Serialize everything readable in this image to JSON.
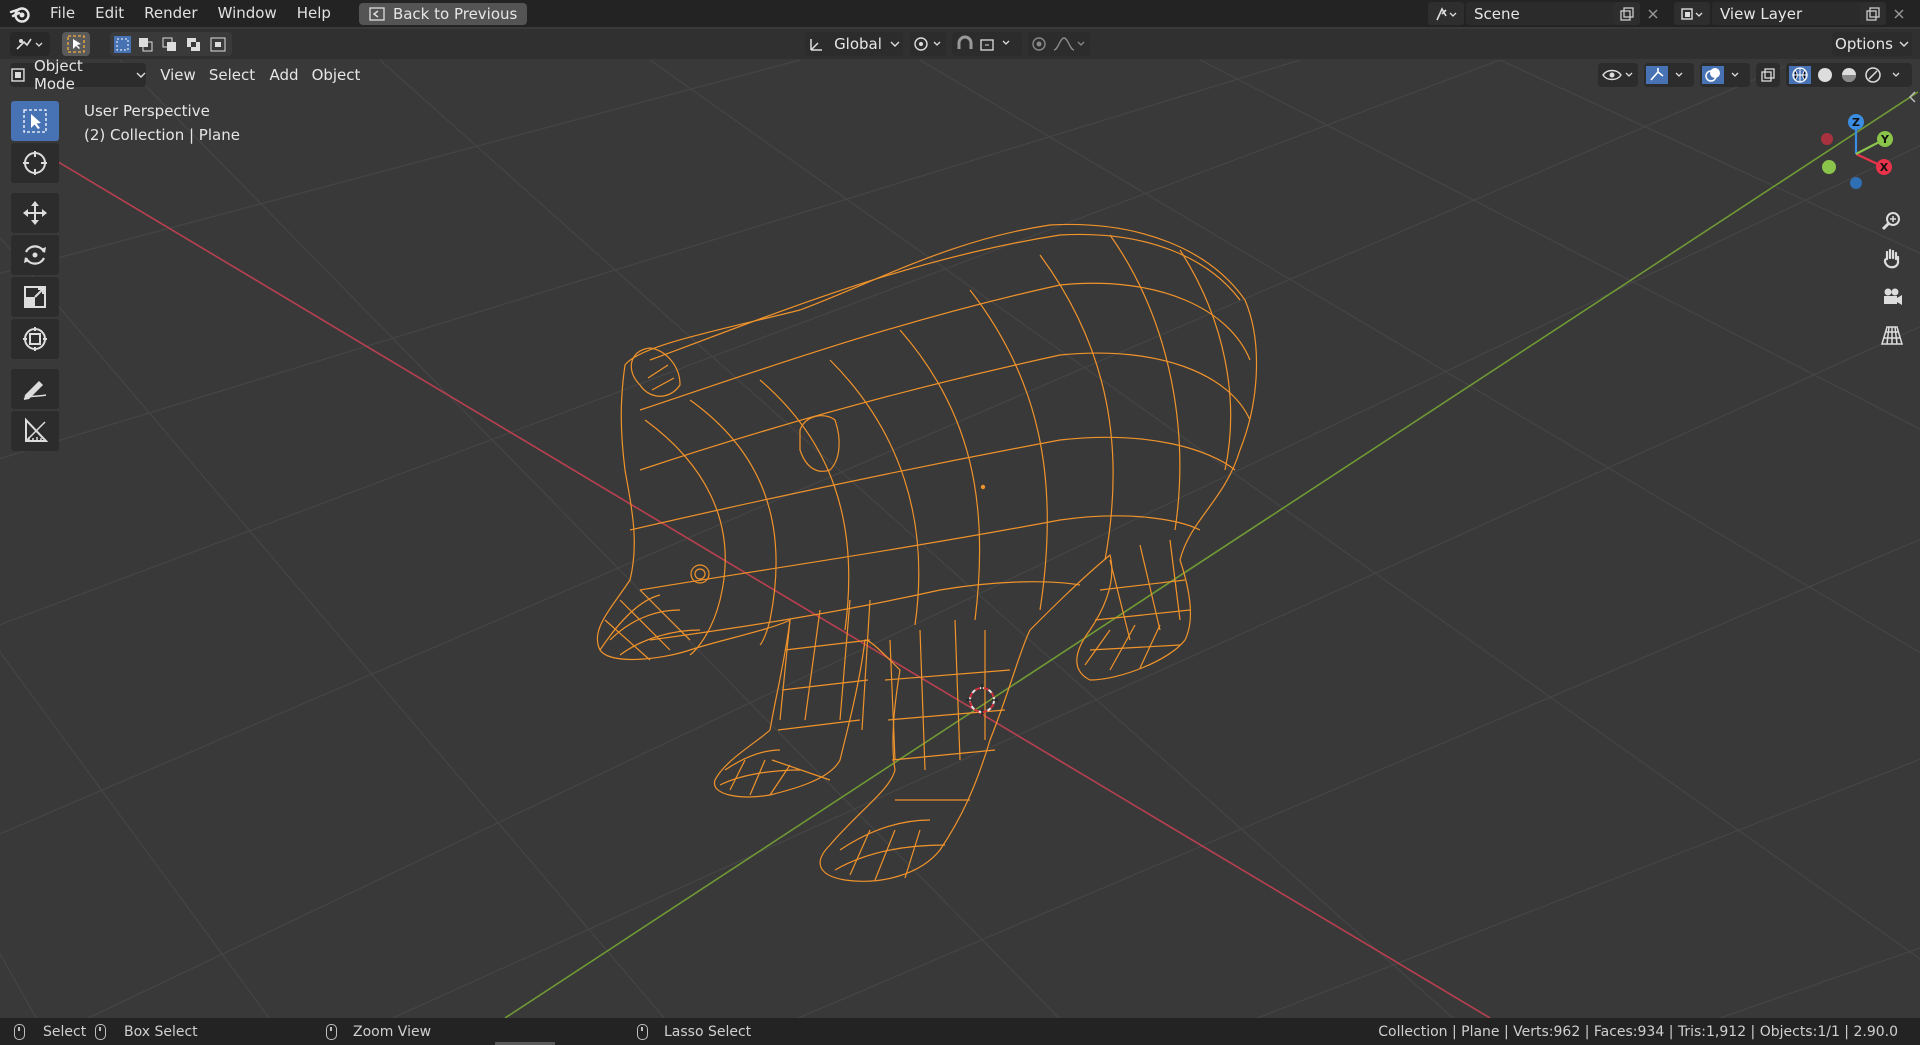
{
  "topbar": {
    "menus": [
      "File",
      "Edit",
      "Render",
      "Window",
      "Help"
    ],
    "back_button": "Back to Previous",
    "scene": "Scene",
    "view_layer": "View Layer"
  },
  "header": {
    "transform_orientation": "Global",
    "options": "Options"
  },
  "viewport_header": {
    "mode": "Object Mode",
    "menus": [
      "View",
      "Select",
      "Add",
      "Object"
    ]
  },
  "overlay": {
    "perspective": "User Perspective",
    "collection": "(2) Collection | Plane"
  },
  "gizmo": {
    "x": "X",
    "y": "Y",
    "z": "Z",
    "colors": {
      "x": "#e8334a",
      "y": "#8bc44a",
      "z": "#3b8de2"
    }
  },
  "toolbar": {
    "tools": [
      "select-box",
      "cursor",
      "move",
      "rotate",
      "scale",
      "transform",
      "annotate",
      "measure"
    ]
  },
  "statusbar": {
    "select": "Select",
    "box_select": "Box Select",
    "zoom_view": "Zoom View",
    "lasso_select": "Lasso Select",
    "stats": "Collection | Plane | Verts:962 | Faces:934 | Tris:1,912 | Objects:1/1 | 2.90.0"
  },
  "colors": {
    "selected_wire": "#f0932b",
    "x_axis": "#b8404f",
    "y_axis": "#6f9a34",
    "active_tool": "#4772b3"
  }
}
